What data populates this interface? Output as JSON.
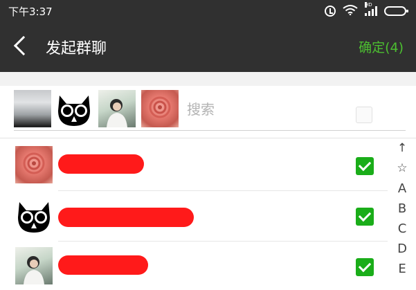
{
  "status_bar": {
    "time": "下午3:37",
    "signal_label": "HD",
    "icons": [
      "alarm-icon",
      "wifi-icon",
      "signal-icon",
      "battery-icon"
    ]
  },
  "header": {
    "title": "发起群聊",
    "confirm_label": "确定(4)",
    "confirm_color": "#4cbf30"
  },
  "selected": {
    "avatars": [
      "snow-scene-avatar",
      "black-cat-avatar",
      "girl-photo-avatar",
      "rose-avatar"
    ],
    "search_placeholder": "搜索"
  },
  "contacts": [
    {
      "avatar": "rose-avatar",
      "checked": true
    },
    {
      "avatar": "black-cat-avatar",
      "checked": true
    },
    {
      "avatar": "girl-photo-avatar",
      "checked": true
    }
  ],
  "index_bar": [
    "↑",
    "☆",
    "A",
    "B",
    "C",
    "D",
    "E"
  ],
  "colors": {
    "header_bg": "#303030",
    "check_green": "#1aad19",
    "redaction": "#ff1a1a"
  }
}
